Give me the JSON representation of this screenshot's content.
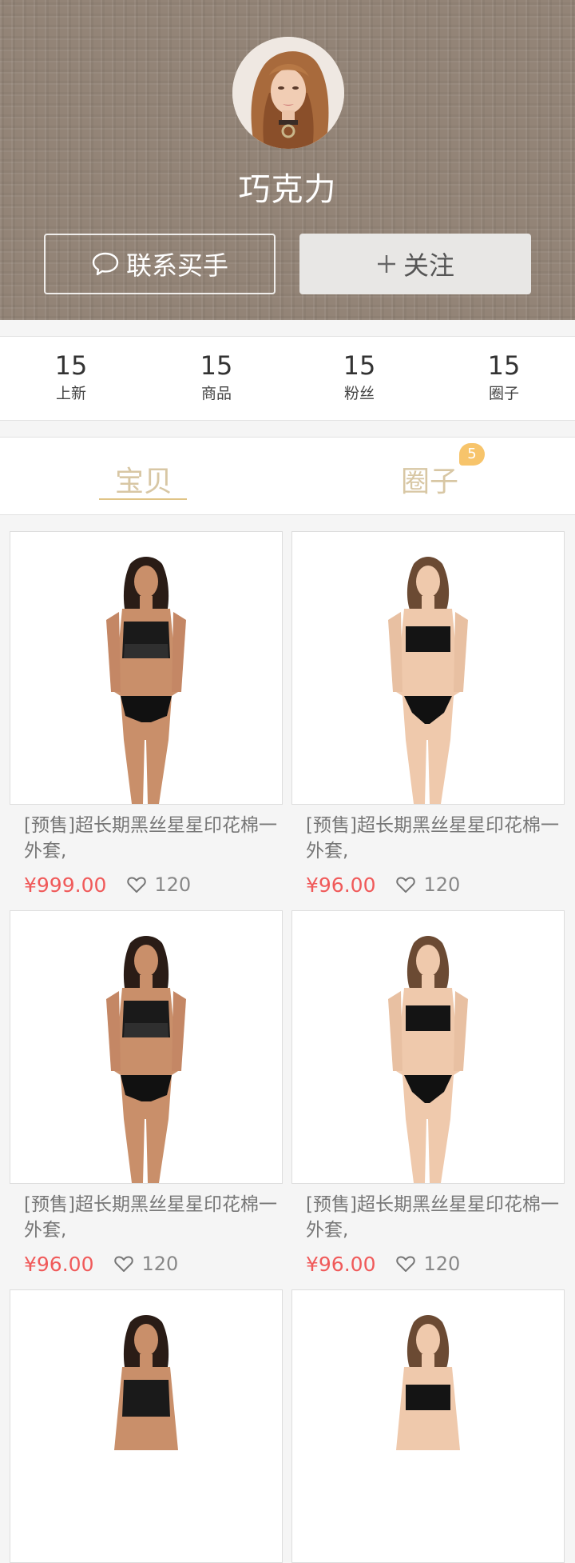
{
  "profile": {
    "name": "巧克力",
    "contact_label": "联系买手",
    "follow_label": "关注"
  },
  "stats": [
    {
      "value": "15",
      "label": "上新"
    },
    {
      "value": "15",
      "label": "商品"
    },
    {
      "value": "15",
      "label": "粉丝"
    },
    {
      "value": "15",
      "label": "圈子"
    }
  ],
  "tabs": {
    "items": [
      "宝贝",
      "圈子"
    ],
    "active": "宝贝",
    "circle_badge": "5"
  },
  "products": [
    {
      "title": "[预售]超长期黑丝星星印花棉一外套,",
      "price": "¥999.00",
      "likes": "120"
    },
    {
      "title": "[预售]超长期黑丝星星印花棉一外套,",
      "price": "¥96.00",
      "likes": "120"
    },
    {
      "title": "[预售]超长期黑丝星星印花棉一外套,",
      "price": "¥96.00",
      "likes": "120"
    },
    {
      "title": "[预售]超长期黑丝星星印花棉一外套,",
      "price": "¥96.00",
      "likes": "120"
    }
  ],
  "colors": {
    "header_bg": "#938477",
    "accent_gold": "#d8c7a4",
    "price_red": "#f05a5a",
    "badge": "#f7c46b"
  },
  "icons": {
    "contact": "chat-bubble-icon",
    "follow": "plus-icon",
    "like": "heart-icon"
  }
}
